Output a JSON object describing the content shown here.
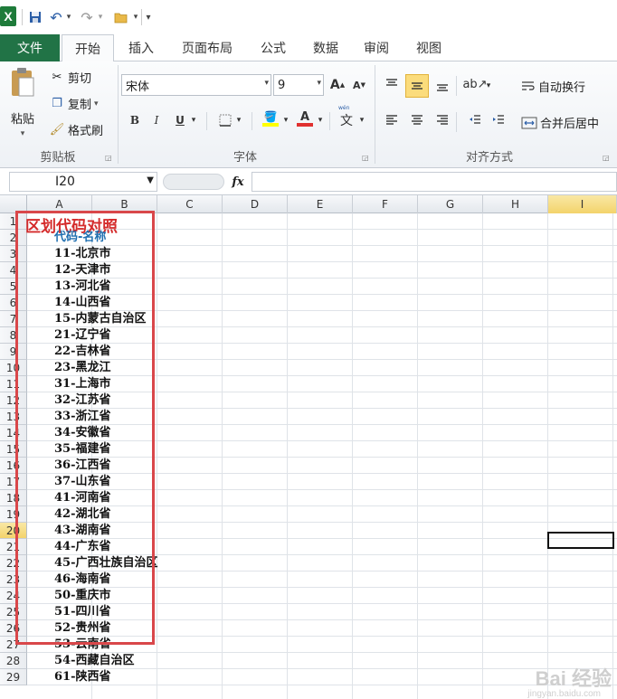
{
  "qat": {
    "logo": "X",
    "undo": "↶",
    "redo": "↷",
    "open": "📂",
    "more": "▾"
  },
  "tabs": [
    "文件",
    "开始",
    "插入",
    "页面布局",
    "公式",
    "数据",
    "审阅",
    "视图"
  ],
  "active_tab": "开始",
  "ribbon": {
    "clipboard": {
      "paste": "粘贴",
      "cut": "剪切",
      "copy": "复制",
      "format_painter": "格式刷",
      "label": "剪贴板"
    },
    "font": {
      "name": "宋体",
      "size": "9",
      "grow": "A",
      "shrink": "A",
      "bold": "B",
      "italic": "I",
      "underline": "U",
      "font_color": "A",
      "phonetic": "文",
      "label": "字体",
      "fill_color": "#ffff00",
      "text_color": "#e0302f"
    },
    "alignment": {
      "wrap": "自动换行",
      "merge": "合并后居中",
      "label": "对齐方式"
    }
  },
  "formula_bar": {
    "name_box": "I20",
    "fx": "fx",
    "value": ""
  },
  "columns": [
    "A",
    "B",
    "C",
    "D",
    "E",
    "F",
    "G",
    "H",
    "I"
  ],
  "selected_column": "I",
  "selected_row": 20,
  "rows": [
    "1",
    "2",
    "3",
    "4",
    "5",
    "6",
    "7",
    "8",
    "9",
    "10",
    "11",
    "12",
    "13",
    "14",
    "15",
    "16",
    "17",
    "18",
    "19",
    "20",
    "21",
    "22",
    "23",
    "24",
    "25",
    "26",
    "27",
    "28",
    "29"
  ],
  "sheet": {
    "title": "区划代码对照",
    "header": "代码-名称",
    "entries": [
      "11-北京市",
      "12-天津市",
      "13-河北省",
      "14-山西省",
      "15-内蒙古自治区",
      "21-辽宁省",
      "22-吉林省",
      "23-黑龙江",
      "31-上海市",
      "32-江苏省",
      "33-浙江省",
      "34-安徽省",
      "35-福建省",
      "36-江西省",
      "37-山东省",
      "41-河南省",
      "42-湖北省",
      "43-湖南省",
      "44-广东省",
      "45-广西壮族自治区",
      "46-海南省",
      "50-重庆市",
      "51-四川省",
      "52-贵州省",
      "53-云南省",
      "54-西藏自治区",
      "61-陕西省"
    ]
  },
  "watermark": "Bai 经验",
  "watermark_url": "jingyan.baidu.com"
}
